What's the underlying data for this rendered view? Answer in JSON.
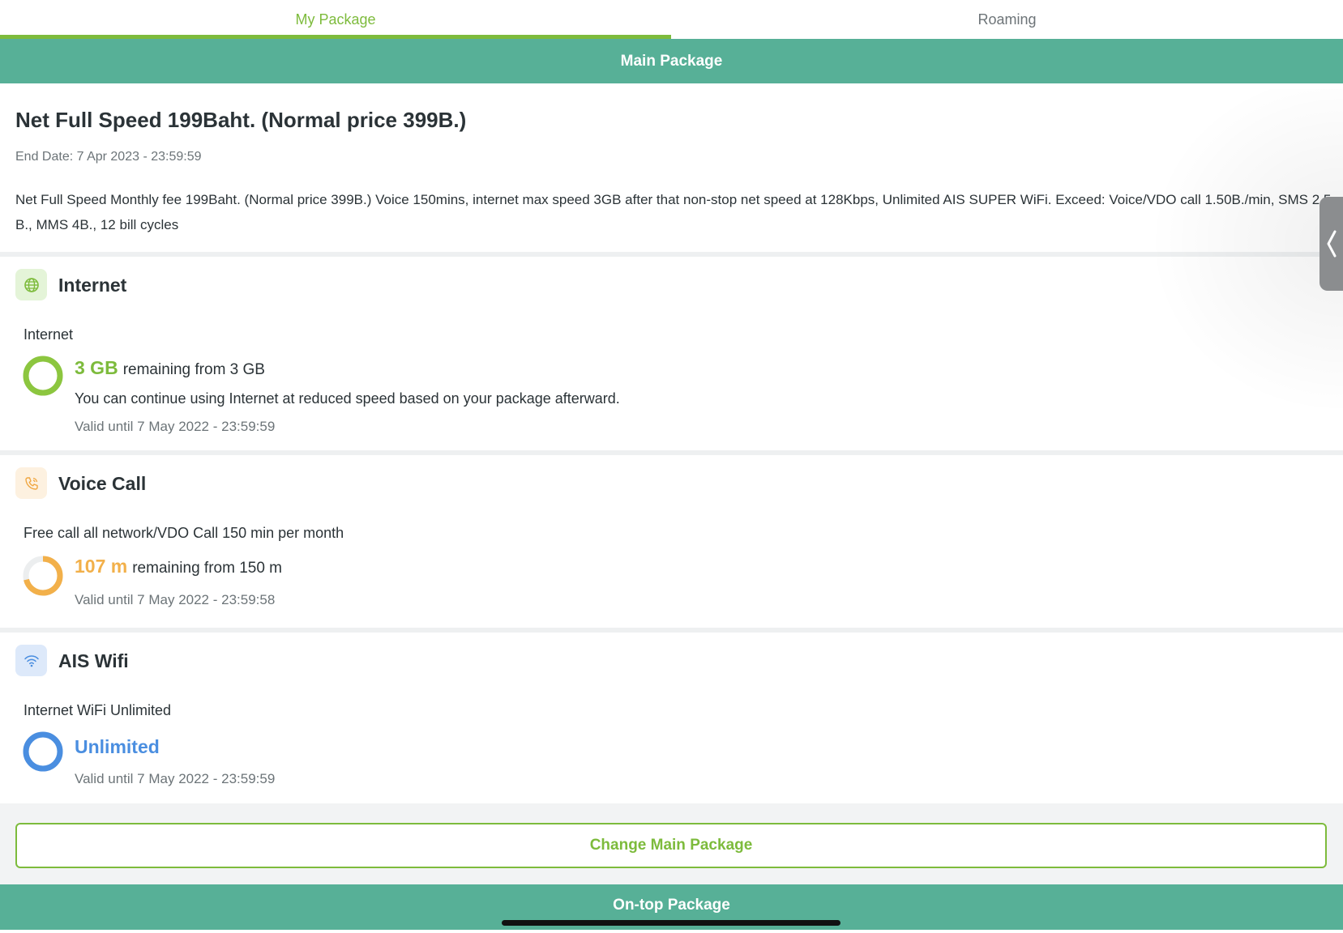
{
  "tabs": [
    {
      "label": "My Package",
      "active": true
    },
    {
      "label": "Roaming",
      "active": false
    }
  ],
  "main_header": "Main Package",
  "package": {
    "title": "Net Full Speed 199Baht. (Normal price 399B.)",
    "end_date": "End Date: 7 Apr 2023 - 23:59:59",
    "description": "Net Full Speed Monthly fee 199Baht. (Normal price 399B.) Voice 150mins, internet max speed 3GB after that non-stop net speed at 128Kbps, Unlimited AIS SUPER WiFi. Exceed: Voice/VDO call 1.50B./min, SMS 2.5 B., MMS 4B., 12 bill cycles"
  },
  "internet": {
    "title": "Internet",
    "icon": "globe-icon",
    "subtitle": "Internet",
    "amount": "3 GB",
    "remaining_text": "remaining from 3 GB",
    "note": "You can continue using Internet at reduced speed based on your package afterward.",
    "valid": "Valid until 7 May 2022 - 23:59:59",
    "fraction_remaining": 1.0,
    "color": "#8cc63f"
  },
  "voice": {
    "title": "Voice Call",
    "icon": "phone-icon",
    "subtitle": "Free call all network/VDO Call 150 min per month",
    "amount": "107 m",
    "remaining_text": "remaining from 150 m",
    "valid": "Valid until 7 May 2022 - 23:59:58",
    "fraction_remaining": 0.713,
    "color": "#f2b04a"
  },
  "wifi": {
    "title": "AIS Wifi",
    "icon": "wifi-icon",
    "subtitle": "Internet WiFi Unlimited",
    "amount": "Unlimited",
    "valid": "Valid until 7 May 2022 - 23:59:59",
    "fraction_remaining": 1.0,
    "color": "#4a8ee0"
  },
  "change_button": "Change Main Package",
  "ontop_header": "On-top Package",
  "colors": {
    "accent_green": "#7dbb3c",
    "header_teal": "#57b097"
  }
}
